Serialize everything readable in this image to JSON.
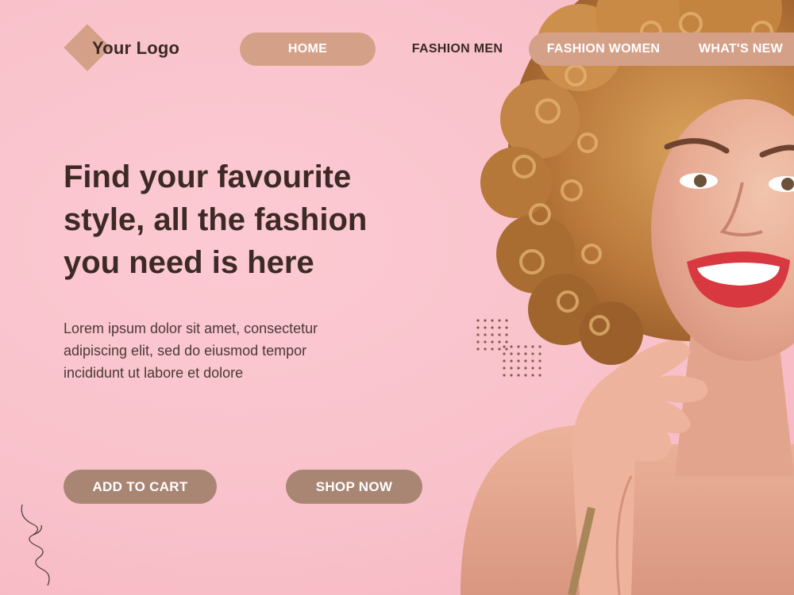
{
  "logo": {
    "text": "Your Logo",
    "mark_color": "#d5a088"
  },
  "nav": {
    "items": [
      {
        "label": "HOME",
        "active": true
      },
      {
        "label": "FASHION MEN",
        "active": false
      },
      {
        "label": "FASHION WOMEN",
        "active": true
      },
      {
        "label": "WHAT'S  NEW",
        "active": true
      }
    ]
  },
  "hero": {
    "headline_lines": [
      "Find your favourite",
      "style, all the fashion",
      "you need is here"
    ],
    "description_lines": [
      "Lorem ipsum dolor sit amet, consectetur",
      "adipiscing elit, sed do eiusmod tempor",
      "incididunt ut labore et dolore"
    ]
  },
  "buttons": {
    "add_to_cart": "ADD TO CART",
    "shop_now": "SHOP NOW"
  },
  "colors": {
    "background": "#f8c7cf",
    "accent": "#d5a088",
    "button": "#a98574",
    "text_dark": "#3d2a26"
  },
  "images": {
    "portrait": "smiling-woman-curly-hair-photo"
  }
}
